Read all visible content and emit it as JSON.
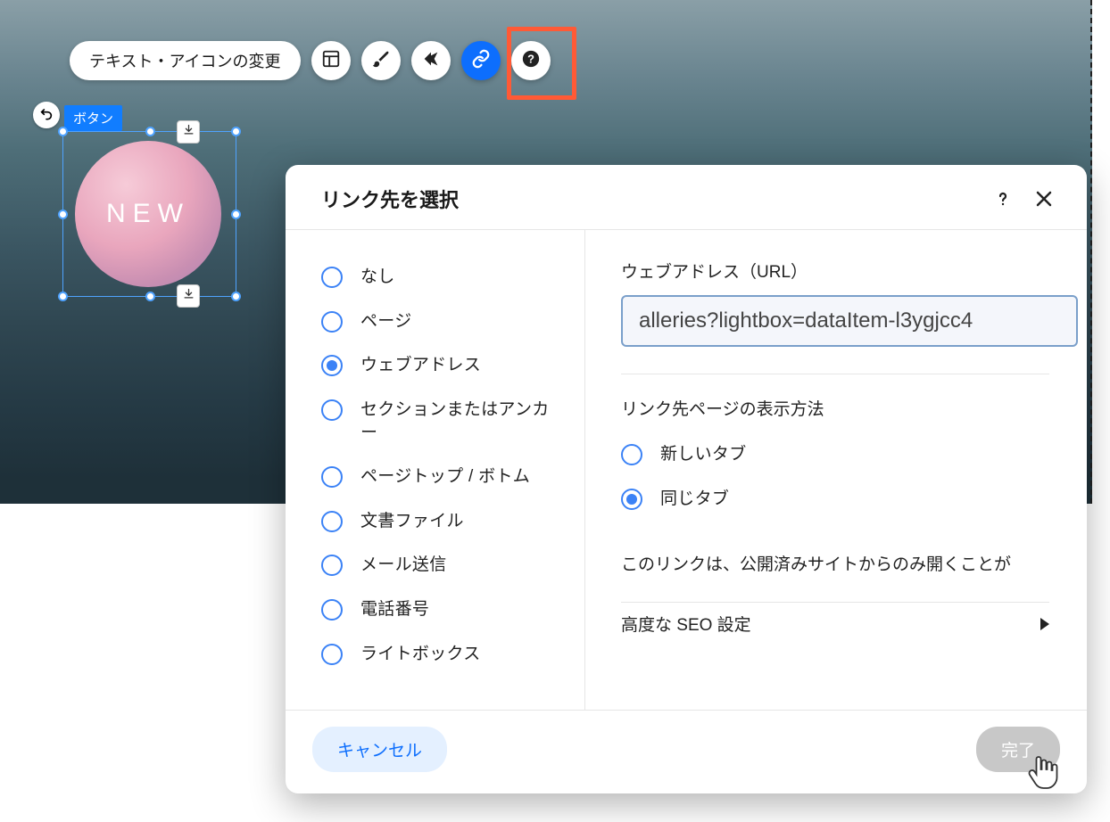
{
  "toolbar": {
    "text_icon_change": "テキスト・アイコンの変更"
  },
  "selection": {
    "label": "ボタン",
    "button_text": "NEW"
  },
  "modal": {
    "title": "リンク先を選択",
    "left_options": [
      {
        "label": "なし",
        "selected": false
      },
      {
        "label": "ページ",
        "selected": false
      },
      {
        "label": "ウェブアドレス",
        "selected": true
      },
      {
        "label": "セクションまたはアンカー",
        "selected": false
      },
      {
        "label": "ページトップ / ボトム",
        "selected": false
      },
      {
        "label": "文書ファイル",
        "selected": false
      },
      {
        "label": "メール送信",
        "selected": false
      },
      {
        "label": "電話番号",
        "selected": false
      },
      {
        "label": "ライトボックス",
        "selected": false
      }
    ],
    "right": {
      "url_label": "ウェブアドレス（URL）",
      "url_value": "alleries?lightbox=dataItem-l3ygjcc4",
      "open_label": "リンク先ページの表示方法",
      "open_options": [
        {
          "label": "新しいタブ",
          "selected": false
        },
        {
          "label": "同じタブ",
          "selected": true
        }
      ],
      "note": "このリンクは、公開済みサイトからのみ開くことが",
      "seo_label": "高度な SEO 設定"
    },
    "footer": {
      "cancel": "キャンセル",
      "done": "完了"
    }
  },
  "icons": {
    "layout": "layout-icon",
    "brush": "brush-icon",
    "animations": "animations-icon",
    "link": "link-icon",
    "help": "help-icon"
  }
}
